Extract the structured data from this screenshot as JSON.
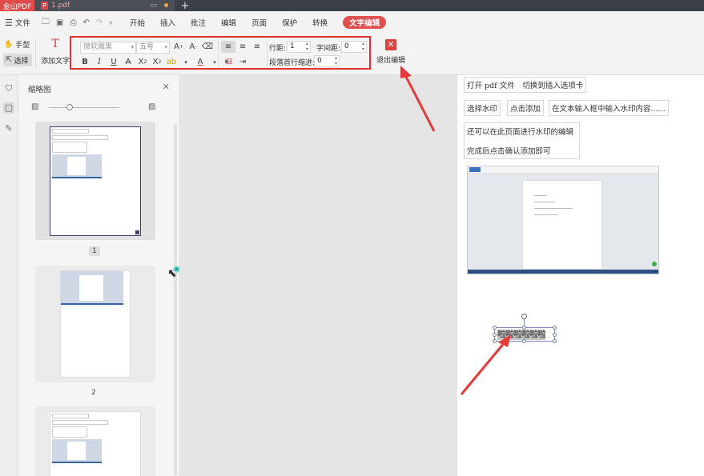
{
  "tabbar": {
    "app_tab": "金山PDF",
    "doc_tab": "1.pdf",
    "pdf_badge": "P",
    "add_tab": "+"
  },
  "menubar": {
    "file_label": "文件",
    "items": [
      "开始",
      "插入",
      "批注",
      "编辑",
      "页面",
      "保护",
      "转换"
    ],
    "active_item": "文字编辑"
  },
  "ribbon": {
    "hand_tool": "手型",
    "select_tool": "选择",
    "add_text": "添加文字",
    "font_name": "微软雅黑",
    "font_size": "五号",
    "line_spacing_label": "行距:",
    "line_spacing_value": "1",
    "char_spacing_label": "字间距:",
    "char_spacing_value": "0",
    "first_indent_label": "段落首行缩进:",
    "first_indent_value": "0",
    "exit_label": "退出编辑"
  },
  "thumb_panel": {
    "title": "缩略图",
    "pages": [
      "1",
      "2"
    ]
  },
  "document": {
    "row1": "打开 pdf 文件　切换到插入选项卡",
    "row2_c1": "选择水印",
    "row2_c2": "点击添加",
    "row2_c3": "在文本输入框中输入水印内容......",
    "row3_l1": "还可以在此页面进行水印的编辑",
    "row3_l2": "完成后点击确认添加即可",
    "edit_text": "啦啦啦啦啦啦"
  },
  "colors": {
    "accent": "#e05050",
    "highlight_border": "#e03030",
    "arrow": "#e8393a"
  }
}
